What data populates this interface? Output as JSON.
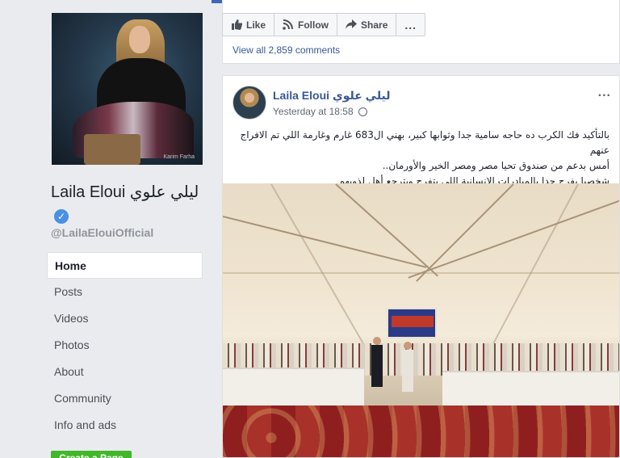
{
  "page": {
    "name": "Laila Eloui ليلي علوي",
    "handle": "@LailaElouiOfficial",
    "cover_watermark": "Karim Farha"
  },
  "nav": {
    "items": [
      {
        "label": "Home"
      },
      {
        "label": "Posts"
      },
      {
        "label": "Videos"
      },
      {
        "label": "Photos"
      },
      {
        "label": "About"
      },
      {
        "label": "Community"
      },
      {
        "label": "Info and ads"
      }
    ],
    "create_button": "Create a Page"
  },
  "actions": {
    "like": "Like",
    "follow": "Follow",
    "share": "Share",
    "more": "..."
  },
  "previous_post": {
    "view_comments": "View all 2,859 comments"
  },
  "post": {
    "author": "Laila Eloui ليلي علوي",
    "timestamp": "Yesterday at 18:58",
    "more": "...",
    "text_line1": "بالتأكيد فك الكرب ده حاجه سامية جدا وثوابها كبير، بهني ال683 غارم وغارمة اللي تم الافراج عنهم",
    "text_line2": "أمس بدعم من صندوق تحيا مصر ومصر الخير والأورمان..",
    "text_line3": "شخصيا بفرح جدا بالمبادرات الانسانية اللي بتفرح وبترجع أهل لذويهم"
  },
  "colors": {
    "brand_blue": "#4267b2",
    "link": "#385898",
    "verified": "#4a90e2",
    "create_green": "#42b72a"
  }
}
